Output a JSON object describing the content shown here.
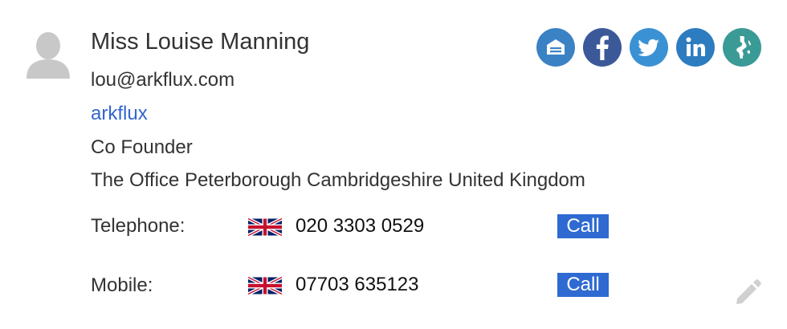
{
  "contact": {
    "name": "Miss Louise Manning",
    "email": "lou@arkflux.com",
    "company": "arkflux",
    "role": "Co Founder",
    "address": "The Office Peterborough Cambridgeshire United Kingdom"
  },
  "phones": [
    {
      "label": "Telephone:",
      "country_flag": "uk-flag-icon",
      "number": "020 3303 0529",
      "action": "Call"
    },
    {
      "label": "Mobile:",
      "country_flag": "uk-flag-icon",
      "number": "07703 635123",
      "action": "Call"
    }
  ],
  "social": [
    {
      "icon": "crm-inbox-icon",
      "color": "#3b82c4"
    },
    {
      "icon": "facebook-icon",
      "color": "#3b5998"
    },
    {
      "icon": "twitter-icon",
      "color": "#3a92d4"
    },
    {
      "icon": "linkedin-icon",
      "color": "#2d7cc0"
    },
    {
      "icon": "global-icon",
      "color": "#3a9a96"
    }
  ],
  "colors": {
    "link": "#3366cc",
    "call_button": "#2e6ad1",
    "avatar": "#c8c8c8",
    "edit_icon": "#d0d0d0"
  }
}
